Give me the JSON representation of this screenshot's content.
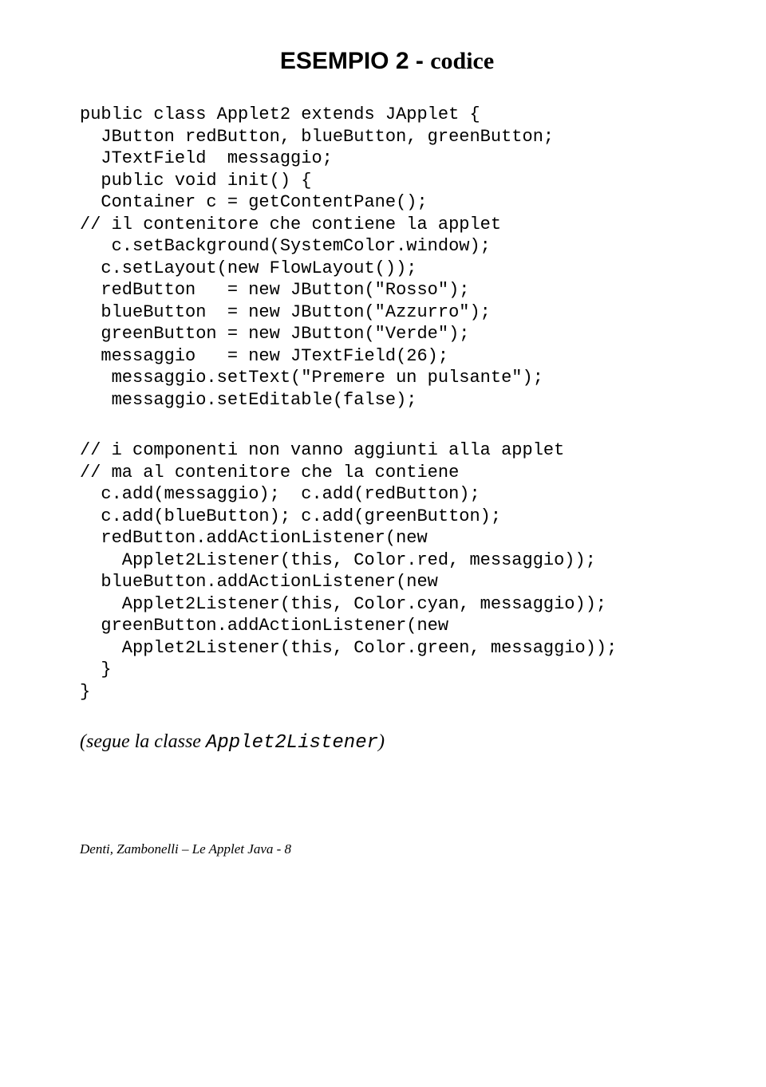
{
  "title": {
    "part1": "ESEMPIO 2",
    "sep": " - ",
    "part2": "codice"
  },
  "code": {
    "block1": "public class Applet2 extends JApplet {\n  JButton redButton, blueButton, greenButton;\n  JTextField  messaggio;\n  public void init() {\n  Container c = getContentPane();\n// il contenitore che contiene la applet\n   c.setBackground(SystemColor.window);\n  c.setLayout(new FlowLayout());\n  redButton   = new JButton(\"Rosso\");\n  blueButton  = new JButton(\"Azzurro\");\n  greenButton = new JButton(\"Verde\");\n  messaggio   = new JTextField(26);\n   messaggio.setText(\"Premere un pulsante\");\n   messaggio.setEditable(false);",
    "block2": "// i componenti non vanno aggiunti alla applet\n// ma al contenitore che la contiene\n  c.add(messaggio);  c.add(redButton);\n  c.add(blueButton); c.add(greenButton);\n  redButton.addActionListener(new\n    Applet2Listener(this, Color.red, messaggio));\n  blueButton.addActionListener(new\n    Applet2Listener(this, Color.cyan, messaggio));\n  greenButton.addActionListener(new\n    Applet2Listener(this, Color.green, messaggio));\n  }\n}"
  },
  "footnote": {
    "prefix": "(segue la classe ",
    "mono": "Applet2Listener",
    "suffix": ")"
  },
  "footer": "Denti, Zambonelli – Le Applet Java - 8"
}
